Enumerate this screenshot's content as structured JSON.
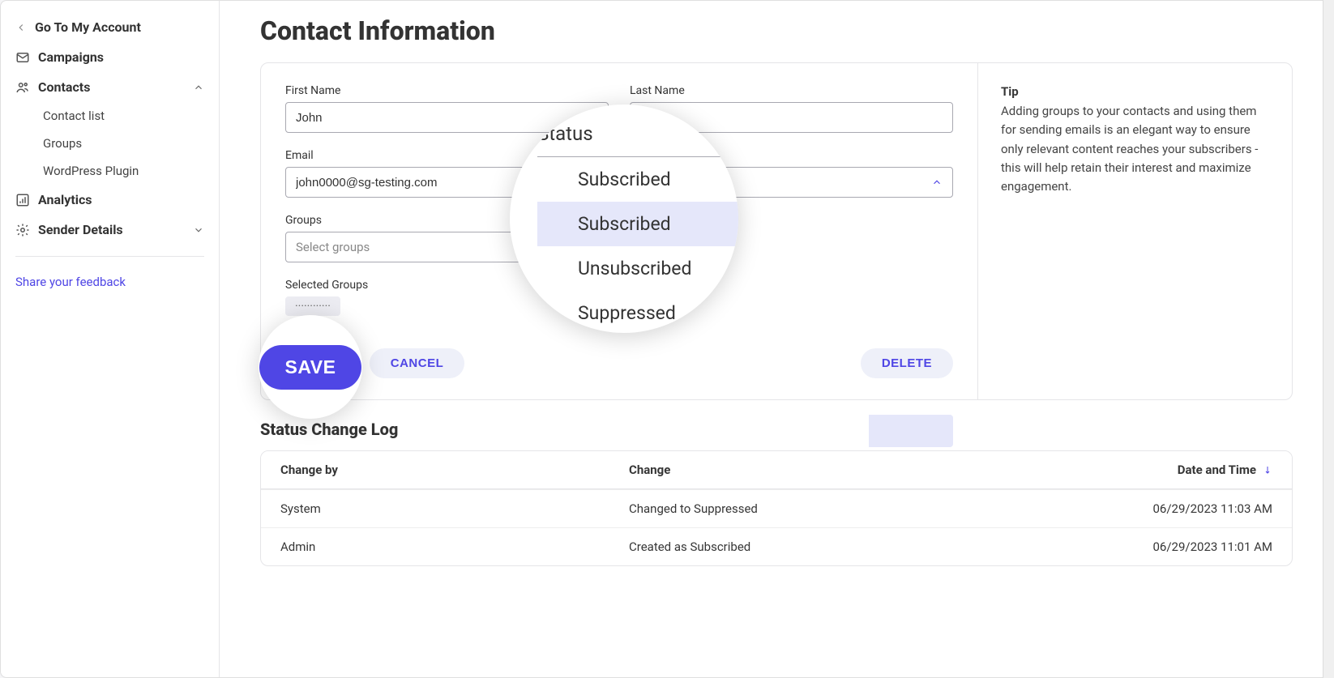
{
  "sidebar": {
    "back": "Go To My Account",
    "campaigns": "Campaigns",
    "contacts": "Contacts",
    "contact_list": "Contact list",
    "groups": "Groups",
    "wp_plugin": "WordPress Plugin",
    "analytics": "Analytics",
    "sender_details": "Sender Details",
    "feedback": "Share your feedback"
  },
  "page": {
    "title": "Contact Information"
  },
  "form": {
    "first_name_label": "First Name",
    "first_name_value": "John",
    "last_name_label": "Last Name",
    "last_name_value": "",
    "email_label": "Email",
    "email_value": "john0000@sg-testing.com",
    "status_label": "Status",
    "status_value": "Subscribed",
    "status_options": [
      "Subscribed",
      "Unsubscribed",
      "Suppressed"
    ],
    "groups_label": "Groups",
    "groups_placeholder": "Select groups",
    "selected_groups_label": "Selected Groups",
    "selected_chip": "············",
    "save": "SAVE",
    "cancel": "CANCEL",
    "delete": "DELETE"
  },
  "tip": {
    "title": "Tip",
    "body": "Adding groups to your contacts and using them for sending emails is an elegant way to ensure only relevant content reaches your subscribers - this will help retain their interest and maximize engagement."
  },
  "zoom": {
    "status_label": "Status",
    "opt_subscribed": "Subscribed",
    "opt_unsubscribed": "Unsubscribed",
    "opt_suppressed": "Suppressed",
    "save": "SAVE"
  },
  "log": {
    "title": "Status Change Log",
    "head": {
      "c1": "Change by",
      "c2": "Change",
      "c3": "Date and Time"
    },
    "rows": [
      {
        "by": "System",
        "change": "Changed to Suppressed",
        "dt": "06/29/2023 11:03 AM"
      },
      {
        "by": "Admin",
        "change": "Created as Subscribed",
        "dt": "06/29/2023 11:01 AM"
      }
    ]
  }
}
